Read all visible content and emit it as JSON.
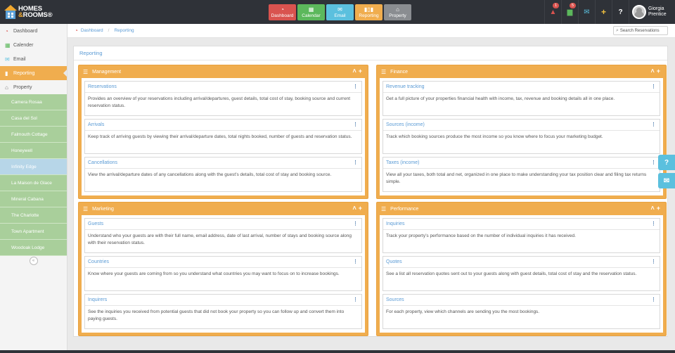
{
  "brand": {
    "line1": "HOMES",
    "amp": "&",
    "line2": "ROOMS",
    "reg": "®"
  },
  "topnav": [
    {
      "label": "Dashboard",
      "icon": "tachometer-icon",
      "color": "#d9534f"
    },
    {
      "label": "Calendar",
      "icon": "calendar-icon",
      "color": "#5cb85c"
    },
    {
      "label": "Email",
      "icon": "envelope-icon",
      "color": "#5bc0de"
    },
    {
      "label": "Reporting",
      "icon": "bar-chart-icon",
      "color": "#f0ad4e"
    },
    {
      "label": "Property",
      "icon": "home-icon",
      "color": "#8a8d91"
    }
  ],
  "notifications": {
    "alerts": "1",
    "tasks": "5"
  },
  "user": {
    "first": "Giorgia",
    "last": "Prentice"
  },
  "sidebar": {
    "items": [
      {
        "label": "Dashboard",
        "icon": "tachometer-icon"
      },
      {
        "label": "Calender",
        "icon": "calendar-icon"
      },
      {
        "label": "Email",
        "icon": "envelope-icon"
      },
      {
        "label": "Reporting",
        "icon": "bar-chart-icon",
        "active": true
      },
      {
        "label": "Property",
        "icon": "home-icon"
      }
    ],
    "properties": [
      "Camera Rosaa",
      "Casa del Sol",
      "Falmouth Cottage",
      "Honeywell",
      "Infinity Edge",
      "La Maison de Glace",
      "Mineral Cabana",
      "The Charlotte",
      "Town Apartment",
      "Woodoak Lodge"
    ],
    "selected_property": "Infinity Edge",
    "collapse_glyph": "«"
  },
  "breadcrumb": {
    "home": "Dashboard",
    "current": "Reporting"
  },
  "search": {
    "placeholder": "Search Reservations"
  },
  "page_title": "Reporting",
  "widgets": {
    "management": {
      "title": "Management",
      "cards": [
        {
          "title": "Reservations",
          "text": "Provides an overview of your reservations including arrival/departures, guest details, total cost of stay, booking source and current reservation status."
        },
        {
          "title": "Arrivals",
          "text": "Keep track of arriving guests by viewing their arrival/departure dates, total nights booked, number of guests and reservation status."
        },
        {
          "title": "Cancellations",
          "text": "View the arrival/departure dates of any cancellations along with the guest’s details, total cost of stay and booking source."
        }
      ]
    },
    "finance": {
      "title": "Finance",
      "cards": [
        {
          "title": "Revenue tracking",
          "text": "Get a full picture of your properties financial health with income, tax, revenue and booking details all in one place."
        },
        {
          "title": "Sources (income)",
          "text": "Track which booking sources produce the most income so you know where to focus your marketing budget."
        },
        {
          "title": "Taxes (income)",
          "text": "View all your taxes, both total and net, organized in one place to make understanding your tax position clear and filing tax returns simple."
        }
      ]
    },
    "marketing": {
      "title": "Marketing",
      "cards": [
        {
          "title": "Guests",
          "text": "Understand who your guests are with their full name, email address, date of last arrival, number of stays and booking source along with their reservation status."
        },
        {
          "title": "Countries",
          "text": "Know where your guests are coming from so you understand what countries you may want to focus on to increase bookings."
        },
        {
          "title": "Inquirers",
          "text": "See the inquiries you received from potential guests that did not book your property so you can follow up and convert them into paying guests."
        }
      ]
    },
    "performance": {
      "title": "Performance",
      "cards": [
        {
          "title": "Inquiries",
          "text": "Track your property’s performance based on the number of individual inquiries it has received."
        },
        {
          "title": "Quotes",
          "text": "See a list all reservation quotes sent out to your guests along with guest details, total cost of stay and the reservation status."
        },
        {
          "title": "Sources",
          "text": "For each property, view which channels are sending you the most bookings."
        }
      ]
    }
  }
}
